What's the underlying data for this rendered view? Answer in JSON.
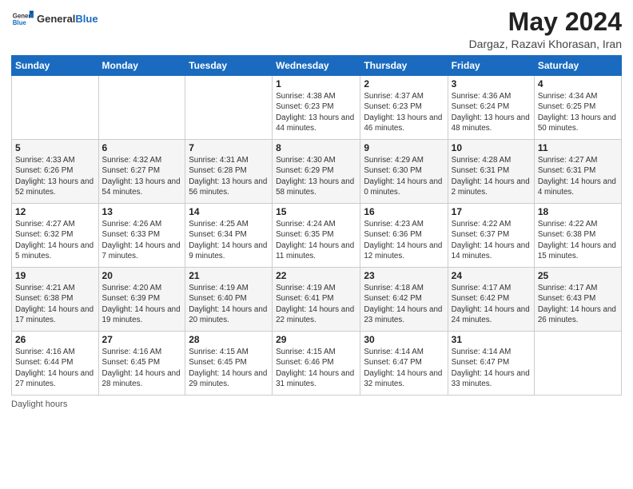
{
  "header": {
    "logo_general": "General",
    "logo_blue": "Blue",
    "month_title": "May 2024",
    "subtitle": "Dargaz, Razavi Khorasan, Iran"
  },
  "days_of_week": [
    "Sunday",
    "Monday",
    "Tuesday",
    "Wednesday",
    "Thursday",
    "Friday",
    "Saturday"
  ],
  "weeks": [
    [
      {
        "day": "",
        "info": ""
      },
      {
        "day": "",
        "info": ""
      },
      {
        "day": "",
        "info": ""
      },
      {
        "day": "1",
        "info": "Sunrise: 4:38 AM\nSunset: 6:23 PM\nDaylight: 13 hours and 44 minutes."
      },
      {
        "day": "2",
        "info": "Sunrise: 4:37 AM\nSunset: 6:23 PM\nDaylight: 13 hours and 46 minutes."
      },
      {
        "day": "3",
        "info": "Sunrise: 4:36 AM\nSunset: 6:24 PM\nDaylight: 13 hours and 48 minutes."
      },
      {
        "day": "4",
        "info": "Sunrise: 4:34 AM\nSunset: 6:25 PM\nDaylight: 13 hours and 50 minutes."
      }
    ],
    [
      {
        "day": "5",
        "info": "Sunrise: 4:33 AM\nSunset: 6:26 PM\nDaylight: 13 hours and 52 minutes."
      },
      {
        "day": "6",
        "info": "Sunrise: 4:32 AM\nSunset: 6:27 PM\nDaylight: 13 hours and 54 minutes."
      },
      {
        "day": "7",
        "info": "Sunrise: 4:31 AM\nSunset: 6:28 PM\nDaylight: 13 hours and 56 minutes."
      },
      {
        "day": "8",
        "info": "Sunrise: 4:30 AM\nSunset: 6:29 PM\nDaylight: 13 hours and 58 minutes."
      },
      {
        "day": "9",
        "info": "Sunrise: 4:29 AM\nSunset: 6:30 PM\nDaylight: 14 hours and 0 minutes."
      },
      {
        "day": "10",
        "info": "Sunrise: 4:28 AM\nSunset: 6:31 PM\nDaylight: 14 hours and 2 minutes."
      },
      {
        "day": "11",
        "info": "Sunrise: 4:27 AM\nSunset: 6:31 PM\nDaylight: 14 hours and 4 minutes."
      }
    ],
    [
      {
        "day": "12",
        "info": "Sunrise: 4:27 AM\nSunset: 6:32 PM\nDaylight: 14 hours and 5 minutes."
      },
      {
        "day": "13",
        "info": "Sunrise: 4:26 AM\nSunset: 6:33 PM\nDaylight: 14 hours and 7 minutes."
      },
      {
        "day": "14",
        "info": "Sunrise: 4:25 AM\nSunset: 6:34 PM\nDaylight: 14 hours and 9 minutes."
      },
      {
        "day": "15",
        "info": "Sunrise: 4:24 AM\nSunset: 6:35 PM\nDaylight: 14 hours and 11 minutes."
      },
      {
        "day": "16",
        "info": "Sunrise: 4:23 AM\nSunset: 6:36 PM\nDaylight: 14 hours and 12 minutes."
      },
      {
        "day": "17",
        "info": "Sunrise: 4:22 AM\nSunset: 6:37 PM\nDaylight: 14 hours and 14 minutes."
      },
      {
        "day": "18",
        "info": "Sunrise: 4:22 AM\nSunset: 6:38 PM\nDaylight: 14 hours and 15 minutes."
      }
    ],
    [
      {
        "day": "19",
        "info": "Sunrise: 4:21 AM\nSunset: 6:38 PM\nDaylight: 14 hours and 17 minutes."
      },
      {
        "day": "20",
        "info": "Sunrise: 4:20 AM\nSunset: 6:39 PM\nDaylight: 14 hours and 19 minutes."
      },
      {
        "day": "21",
        "info": "Sunrise: 4:19 AM\nSunset: 6:40 PM\nDaylight: 14 hours and 20 minutes."
      },
      {
        "day": "22",
        "info": "Sunrise: 4:19 AM\nSunset: 6:41 PM\nDaylight: 14 hours and 22 minutes."
      },
      {
        "day": "23",
        "info": "Sunrise: 4:18 AM\nSunset: 6:42 PM\nDaylight: 14 hours and 23 minutes."
      },
      {
        "day": "24",
        "info": "Sunrise: 4:17 AM\nSunset: 6:42 PM\nDaylight: 14 hours and 24 minutes."
      },
      {
        "day": "25",
        "info": "Sunrise: 4:17 AM\nSunset: 6:43 PM\nDaylight: 14 hours and 26 minutes."
      }
    ],
    [
      {
        "day": "26",
        "info": "Sunrise: 4:16 AM\nSunset: 6:44 PM\nDaylight: 14 hours and 27 minutes."
      },
      {
        "day": "27",
        "info": "Sunrise: 4:16 AM\nSunset: 6:45 PM\nDaylight: 14 hours and 28 minutes."
      },
      {
        "day": "28",
        "info": "Sunrise: 4:15 AM\nSunset: 6:45 PM\nDaylight: 14 hours and 29 minutes."
      },
      {
        "day": "29",
        "info": "Sunrise: 4:15 AM\nSunset: 6:46 PM\nDaylight: 14 hours and 31 minutes."
      },
      {
        "day": "30",
        "info": "Sunrise: 4:14 AM\nSunset: 6:47 PM\nDaylight: 14 hours and 32 minutes."
      },
      {
        "day": "31",
        "info": "Sunrise: 4:14 AM\nSunset: 6:47 PM\nDaylight: 14 hours and 33 minutes."
      },
      {
        "day": "",
        "info": ""
      }
    ]
  ],
  "footer": {
    "label": "Daylight hours"
  }
}
